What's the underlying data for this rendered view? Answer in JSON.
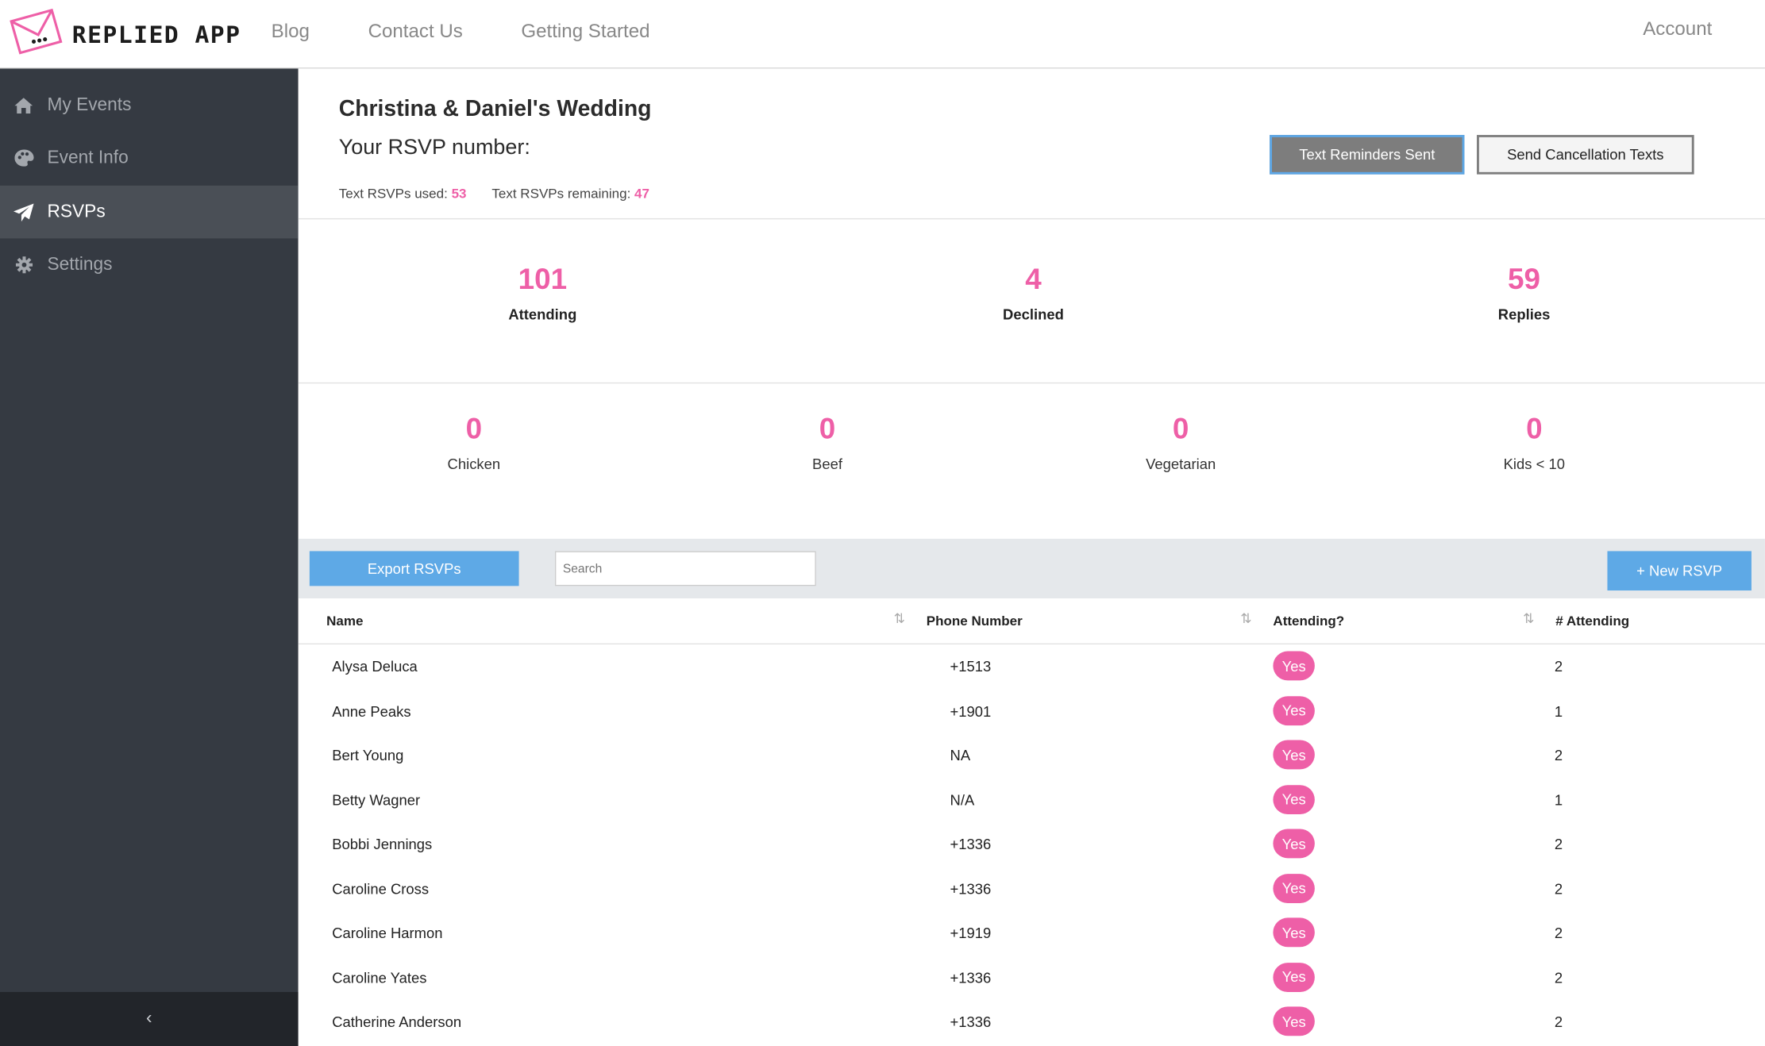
{
  "brand": {
    "name": "REPLIED APP"
  },
  "topnav": {
    "blog": "Blog",
    "contact": "Contact Us",
    "getting_started": "Getting Started",
    "account": "Account"
  },
  "sidebar": {
    "items": [
      {
        "label": "My Events",
        "icon": "home-icon"
      },
      {
        "label": "Event Info",
        "icon": "palette-icon"
      },
      {
        "label": "RSVPs",
        "icon": "paper-plane-icon",
        "active": true
      },
      {
        "label": "Settings",
        "icon": "gear-icon"
      }
    ],
    "collapse": "‹"
  },
  "event": {
    "title": "Christina & Daniel's Wedding",
    "rsvp_number_label": "Your RSVP number:",
    "used_label": "Text RSVPs used:",
    "used_value": "53",
    "remaining_label": "Text RSVPs remaining:",
    "remaining_value": "47"
  },
  "buttons": {
    "reminders": "Text Reminders Sent",
    "cancellation": "Send Cancellation Texts",
    "export": "Export RSVPs",
    "new_rsvp": "+ New RSVP"
  },
  "search": {
    "placeholder": "Search"
  },
  "stats": [
    {
      "value": "101",
      "label": "Attending"
    },
    {
      "value": "4",
      "label": "Declined"
    },
    {
      "value": "59",
      "label": "Replies"
    }
  ],
  "meals": [
    {
      "value": "0",
      "label": "Chicken"
    },
    {
      "value": "0",
      "label": "Beef"
    },
    {
      "value": "0",
      "label": "Vegetarian"
    },
    {
      "value": "0",
      "label": "Kids < 10"
    }
  ],
  "table": {
    "headers": {
      "name": "Name",
      "phone": "Phone Number",
      "attending": "Attending?",
      "count": "# Attending"
    },
    "sort_glyph": "⇅",
    "rows": [
      {
        "name": "Alysa Deluca",
        "phone": "+1513",
        "attending": "Yes",
        "count": "2"
      },
      {
        "name": "Anne Peaks",
        "phone": "+1901",
        "attending": "Yes",
        "count": "1"
      },
      {
        "name": "Bert Young",
        "phone": "NA",
        "attending": "Yes",
        "count": "2"
      },
      {
        "name": "Betty Wagner",
        "phone": "N/A",
        "attending": "Yes",
        "count": "1"
      },
      {
        "name": "Bobbi Jennings",
        "phone": "+1336",
        "attending": "Yes",
        "count": "2"
      },
      {
        "name": "Caroline Cross",
        "phone": "+1336",
        "attending": "Yes",
        "count": "2"
      },
      {
        "name": "Caroline Harmon",
        "phone": "+1919",
        "attending": "Yes",
        "count": "2"
      },
      {
        "name": "Caroline Yates",
        "phone": "+1336",
        "attending": "Yes",
        "count": "2"
      },
      {
        "name": "Catherine Anderson",
        "phone": "+1336",
        "attending": "Yes",
        "count": "2"
      }
    ]
  },
  "colors": {
    "accent": "#ee5fa7",
    "sidebar": "#353a42",
    "button_blue": "#5ea9e6"
  }
}
